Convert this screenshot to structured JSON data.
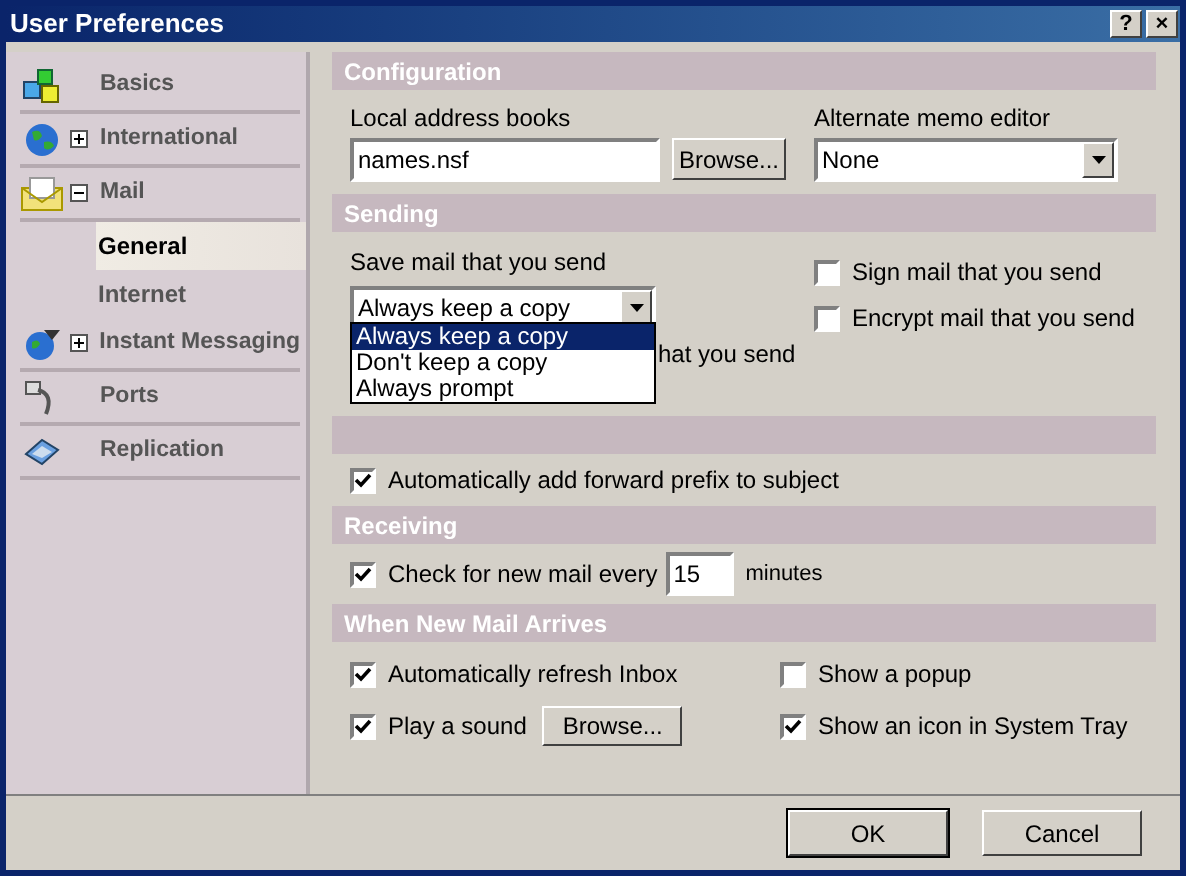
{
  "window": {
    "title": "User Preferences",
    "buttons": [
      "?",
      "×"
    ]
  },
  "sidebar": {
    "items": [
      {
        "label": "Basics",
        "selected": false
      },
      {
        "label": "International",
        "selected": false,
        "expanded": false
      },
      {
        "label": "Mail",
        "selected": false,
        "expanded": true,
        "children": [
          {
            "label": "General",
            "selected": true
          },
          {
            "label": "Internet",
            "selected": false
          }
        ]
      },
      {
        "label": "Instant Messaging",
        "selected": false,
        "expanded": false
      },
      {
        "label": "Ports",
        "selected": false
      },
      {
        "label": "Replication",
        "selected": false
      }
    ]
  },
  "configuration": {
    "title": "Configuration",
    "address_books": {
      "label": "Local address books",
      "value": "names.nsf",
      "button": "Browse..."
    },
    "memo_editor": {
      "label": "Alternate memo editor",
      "value": "None"
    }
  },
  "sending": {
    "title": "Sending",
    "save_mail": {
      "label": "Save mail that you send",
      "value": "Always keep a copy",
      "expanded": true,
      "options": [
        {
          "label": "Always keep a copy",
          "selected": true
        },
        {
          "label": "Don't keep a copy",
          "selected": false
        },
        {
          "label": "Always prompt",
          "selected": false
        }
      ]
    },
    "hidden_check_label": "hat you send",
    "checks": [
      {
        "label": "Sign mail that you send",
        "checked": false
      },
      {
        "label": "Encrypt mail that you send",
        "checked": false
      }
    ]
  },
  "forwarding": {
    "checks": [
      {
        "label": "Automatically add forward prefix to subject",
        "checked": true
      }
    ]
  },
  "receiving": {
    "title": "Receiving",
    "check": {
      "label": "Check for new mail every",
      "checked": true
    },
    "value": "15",
    "unit": "minutes"
  },
  "new_mail": {
    "title": "When New Mail Arrives",
    "left": [
      {
        "kind": "check",
        "label": "Automatically refresh Inbox",
        "checked": true
      },
      {
        "kind": "sound",
        "label": "Play a sound",
        "checked": true,
        "button": "Browse..."
      }
    ],
    "right": [
      {
        "label": "Show a popup",
        "checked": false
      },
      {
        "label": "Show an icon in System Tray",
        "checked": true
      }
    ]
  },
  "buttons": [
    "OK",
    "Cancel"
  ]
}
